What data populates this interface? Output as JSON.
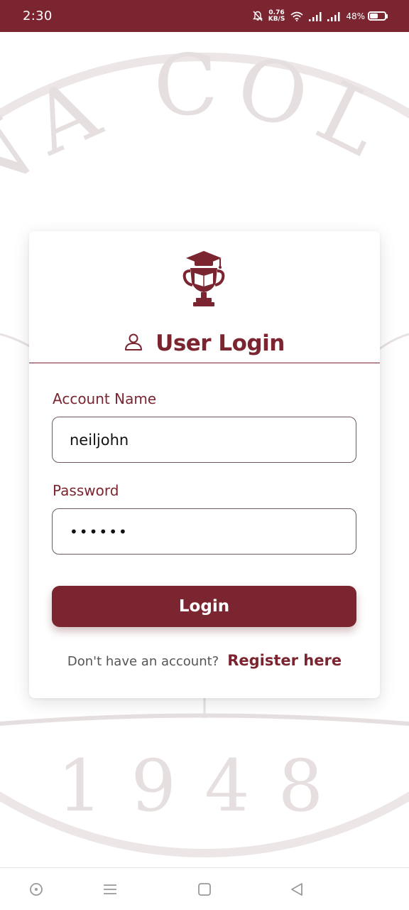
{
  "status_bar": {
    "time": "2:30",
    "net_speed_value": "0.76",
    "net_speed_unit": "KB/S",
    "battery": "48%",
    "battery_level": 0.48,
    "icons": [
      "mute-bell-icon",
      "wifi-icon",
      "signal-icon",
      "signal-icon",
      "battery-icon"
    ]
  },
  "background": {
    "seal_text_top": "NA COL",
    "seal_year": "1948"
  },
  "login": {
    "title": "User Login",
    "account_label": "Account Name",
    "account_value": "neiljohn",
    "password_label": "Password",
    "password_value": "••••••",
    "login_button": "Login",
    "register_question": "Don't have an account?",
    "register_link": "Register here"
  },
  "nav": {
    "icons": [
      "recents-circle-icon",
      "menu-icon",
      "home-square-icon",
      "back-triangle-icon"
    ]
  },
  "colors": {
    "brand": "#7a2530",
    "background": "#ffffff",
    "seal": "#e4dcdd"
  }
}
